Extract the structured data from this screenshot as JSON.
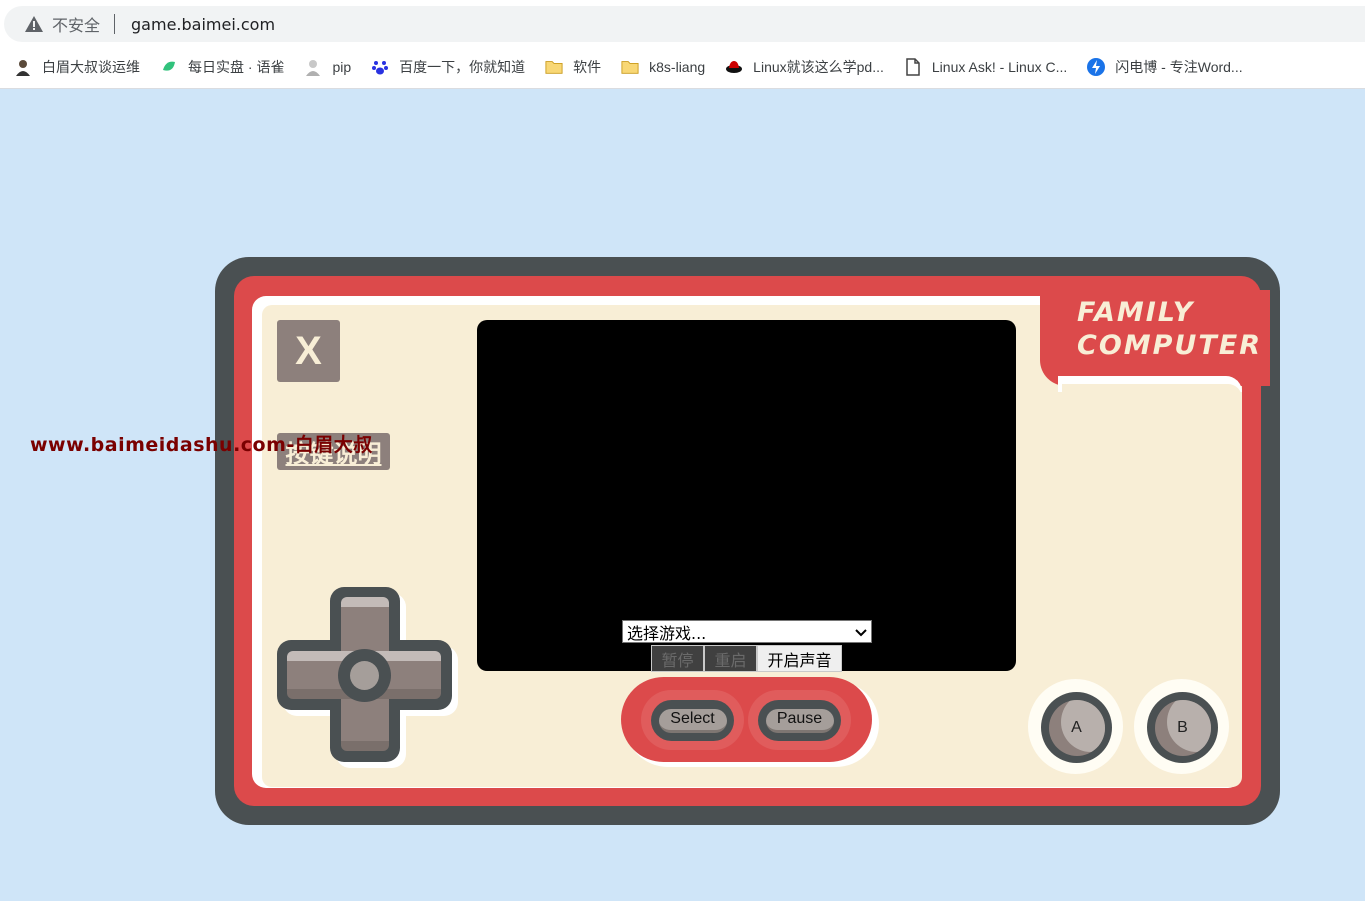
{
  "browser": {
    "security_label": "不安全",
    "url": "game.baimei.com",
    "bookmarks": [
      {
        "label": "白眉大叔谈运维",
        "icon": "avatar-icon"
      },
      {
        "label": "每日实盘 · 语雀",
        "icon": "yuque-icon"
      },
      {
        "label": "pip",
        "icon": "user-icon"
      },
      {
        "label": "百度一下，你就知道",
        "icon": "baidu-icon"
      },
      {
        "label": "软件",
        "icon": "folder-icon"
      },
      {
        "label": "k8s-liang",
        "icon": "folder-icon"
      },
      {
        "label": "Linux就该这么学pd...",
        "icon": "redhat-icon"
      },
      {
        "label": "Linux Ask! - Linux C...",
        "icon": "page-icon"
      },
      {
        "label": "闪电博 - 专注Word...",
        "icon": "bolt-icon"
      }
    ]
  },
  "console": {
    "brand_line1": "FAMILY",
    "brand_line2": "COMPUTER",
    "x_button": "X",
    "keys_help": "按键说明",
    "watermark": "www.baimeidashu.com-白眉大叔",
    "game_select": {
      "selected": "选择游戏..."
    },
    "controls": {
      "pause": "暂停",
      "restart": "重启",
      "sound": "开启声音"
    },
    "select_label": "Select",
    "pause_label": "Pause",
    "a_label": "A",
    "b_label": "B"
  },
  "colors": {
    "background": "#cfe5f8",
    "console_frame": "#4a5052",
    "console_red": "#dc4a4b",
    "panel_cream": "#f8eed6",
    "button_taupe": "#8d807c"
  }
}
